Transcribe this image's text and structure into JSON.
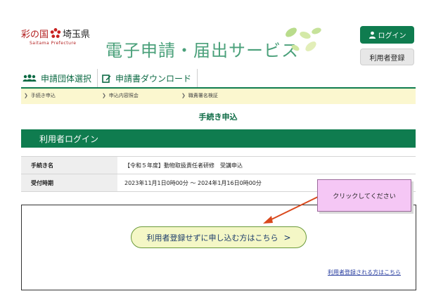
{
  "header": {
    "pref_name_prefix": "彩の国",
    "pref_name": "埼玉県",
    "pref_name_en": "Saitama Prefecture",
    "site_title": "電子申請・届出サービス",
    "login_label": "ログイン",
    "register_label": "利用者登録"
  },
  "nav": {
    "tabs": [
      {
        "label": "申請団体選択"
      },
      {
        "label": "申請書ダウンロード"
      }
    ]
  },
  "steps": [
    {
      "label": "手続き申込"
    },
    {
      "label": "申込内容照会"
    },
    {
      "label": "職責署名検証"
    }
  ],
  "page_heading": "手続き申込",
  "login_section": {
    "title": "利用者ログイン"
  },
  "info": {
    "rows": [
      {
        "label": "手続き名",
        "value": "【令和５年度】動物取扱責任者研修　受講申込"
      },
      {
        "label": "受付時期",
        "value": "2023年11月1日0時00分 ～ 2024年1月16日0時00分"
      }
    ]
  },
  "main": {
    "apply_button_label": "利用者登録せずに申し込む方はこちら",
    "apply_button_arrow": ">",
    "register_link": "利用者登録される方はこちら"
  },
  "callout": {
    "text": "クリックしてください"
  },
  "colors": {
    "brand_green": "#0f7c4f",
    "title_green": "#4aa07a",
    "step_bg": "#fbf7cf",
    "callout_bg": "#f5c7f5",
    "button_bg": "#f4f7c6"
  }
}
